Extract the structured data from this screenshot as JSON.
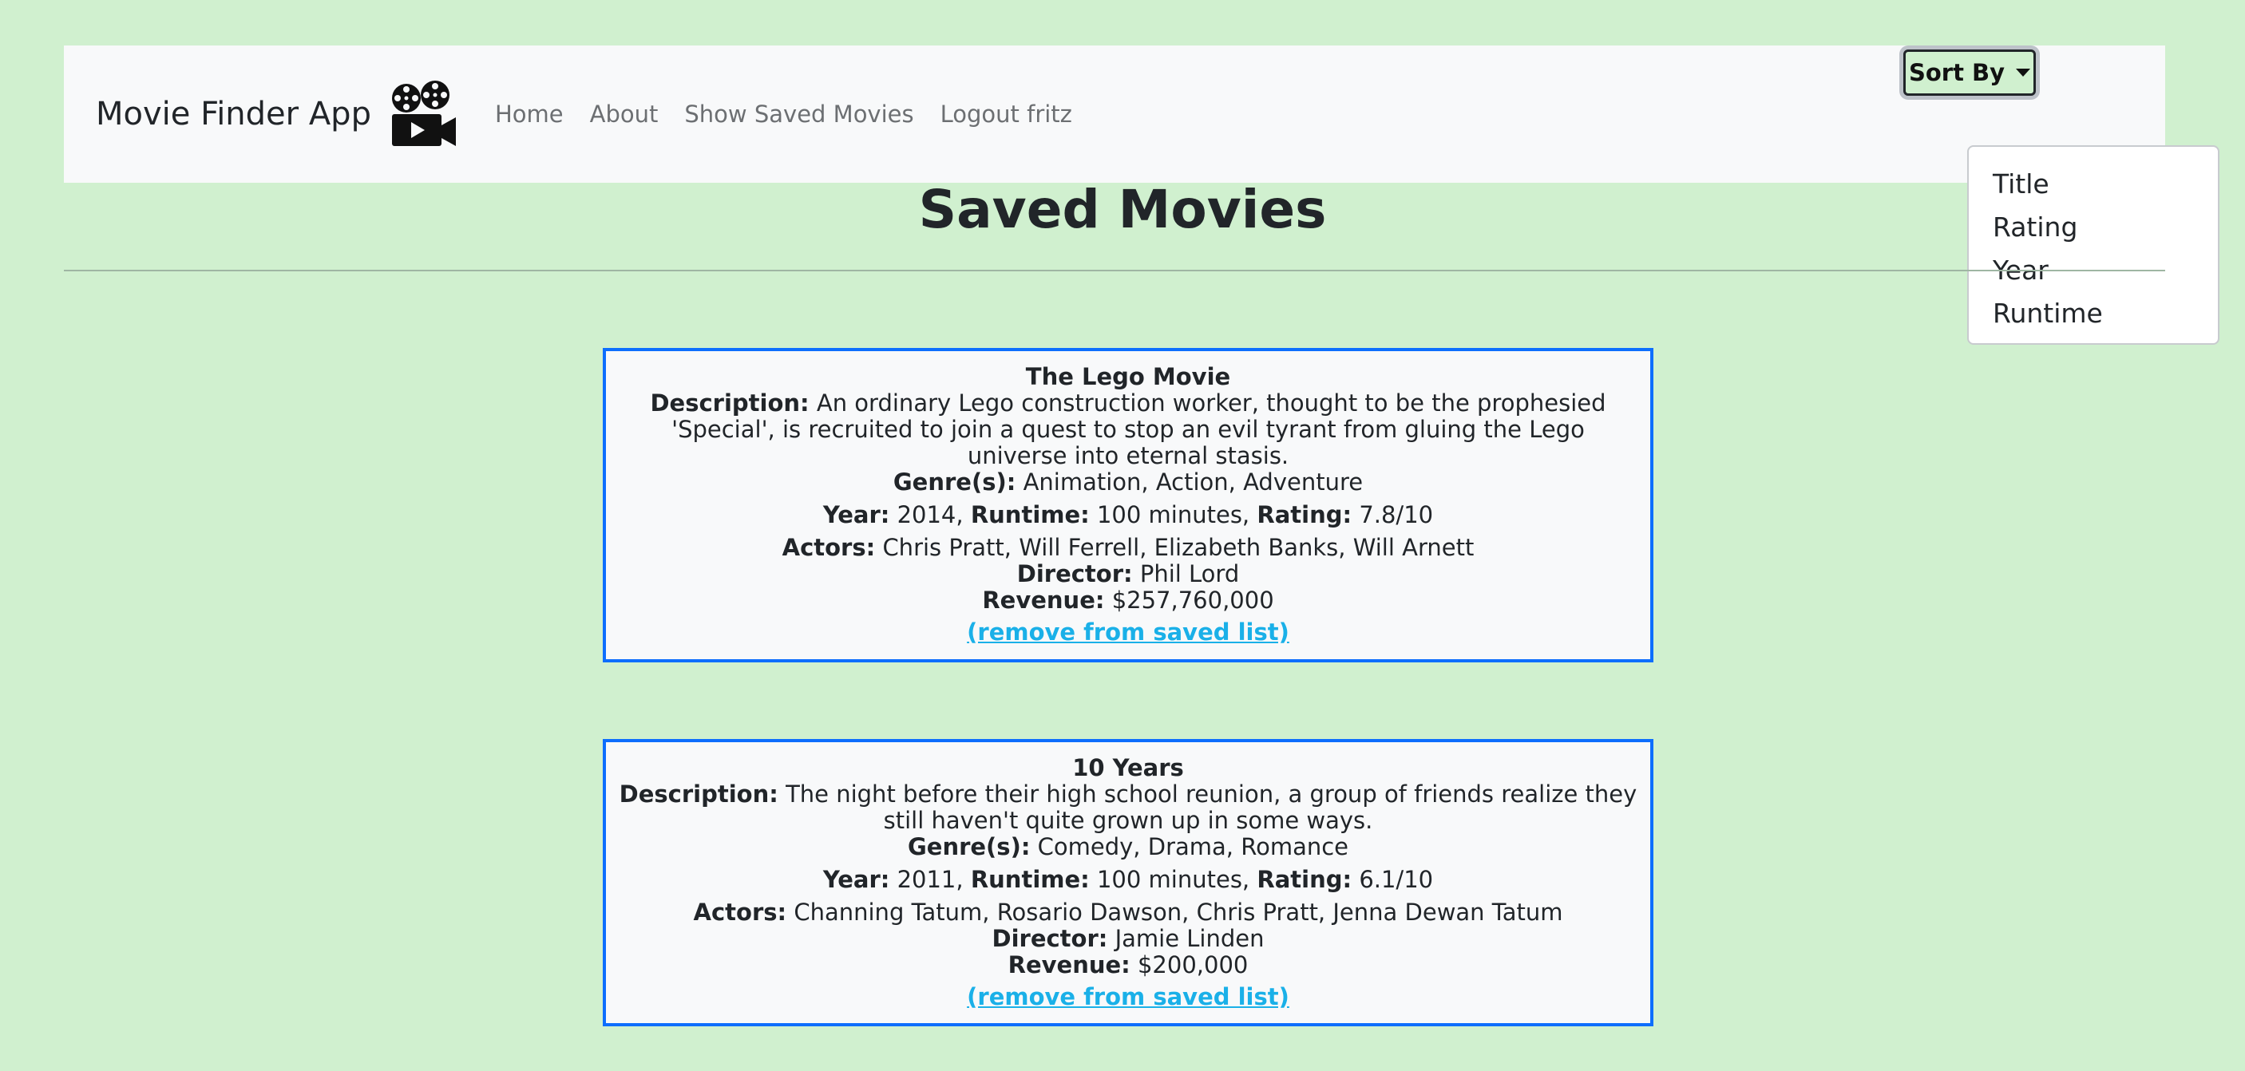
{
  "navbar": {
    "brand": "Movie Finder App",
    "brand_icon": "movie-camera-icon",
    "links": [
      "Home",
      "About",
      "Show Saved Movies",
      "Logout fritz"
    ]
  },
  "sort": {
    "button_label": "Sort By",
    "options": [
      "Title",
      "Rating",
      "Year",
      "Runtime"
    ]
  },
  "page": {
    "title": "Saved Movies"
  },
  "labels": {
    "description": "Description:",
    "genres": "Genre(s):",
    "year": "Year:",
    "runtime": "Runtime:",
    "rating": "Rating:",
    "actors": "Actors:",
    "director": "Director:",
    "revenue": "Revenue:",
    "remove": "(remove from saved list)"
  },
  "movies": [
    {
      "title": "The Lego Movie",
      "description": "An ordinary Lego construction worker, thought to be the prophesied 'Special', is recruited to join a quest to stop an evil tyrant from gluing the Lego universe into eternal stasis.",
      "genres": "Animation, Action, Adventure",
      "year": "2014,",
      "runtime": "100 minutes,",
      "rating": "7.8/10",
      "actors": "Chris Pratt, Will Ferrell, Elizabeth Banks, Will Arnett",
      "director": "Phil Lord",
      "revenue": "$257,760,000"
    },
    {
      "title": "10 Years",
      "description": "The night before their high school reunion, a group of friends realize they still haven't quite grown up in some ways.",
      "genres": "Comedy, Drama, Romance",
      "year": "2011,",
      "runtime": "100 minutes,",
      "rating": "6.1/10",
      "actors": "Channing Tatum, Rosario Dawson, Chris Pratt, Jenna Dewan Tatum",
      "director": "Jamie Linden",
      "revenue": "$200,000"
    }
  ],
  "colors": {
    "background": "#d0f0cf",
    "navbar": "#f8f9fa",
    "card_border": "#0d6efd",
    "link": "#1ab0e8"
  }
}
